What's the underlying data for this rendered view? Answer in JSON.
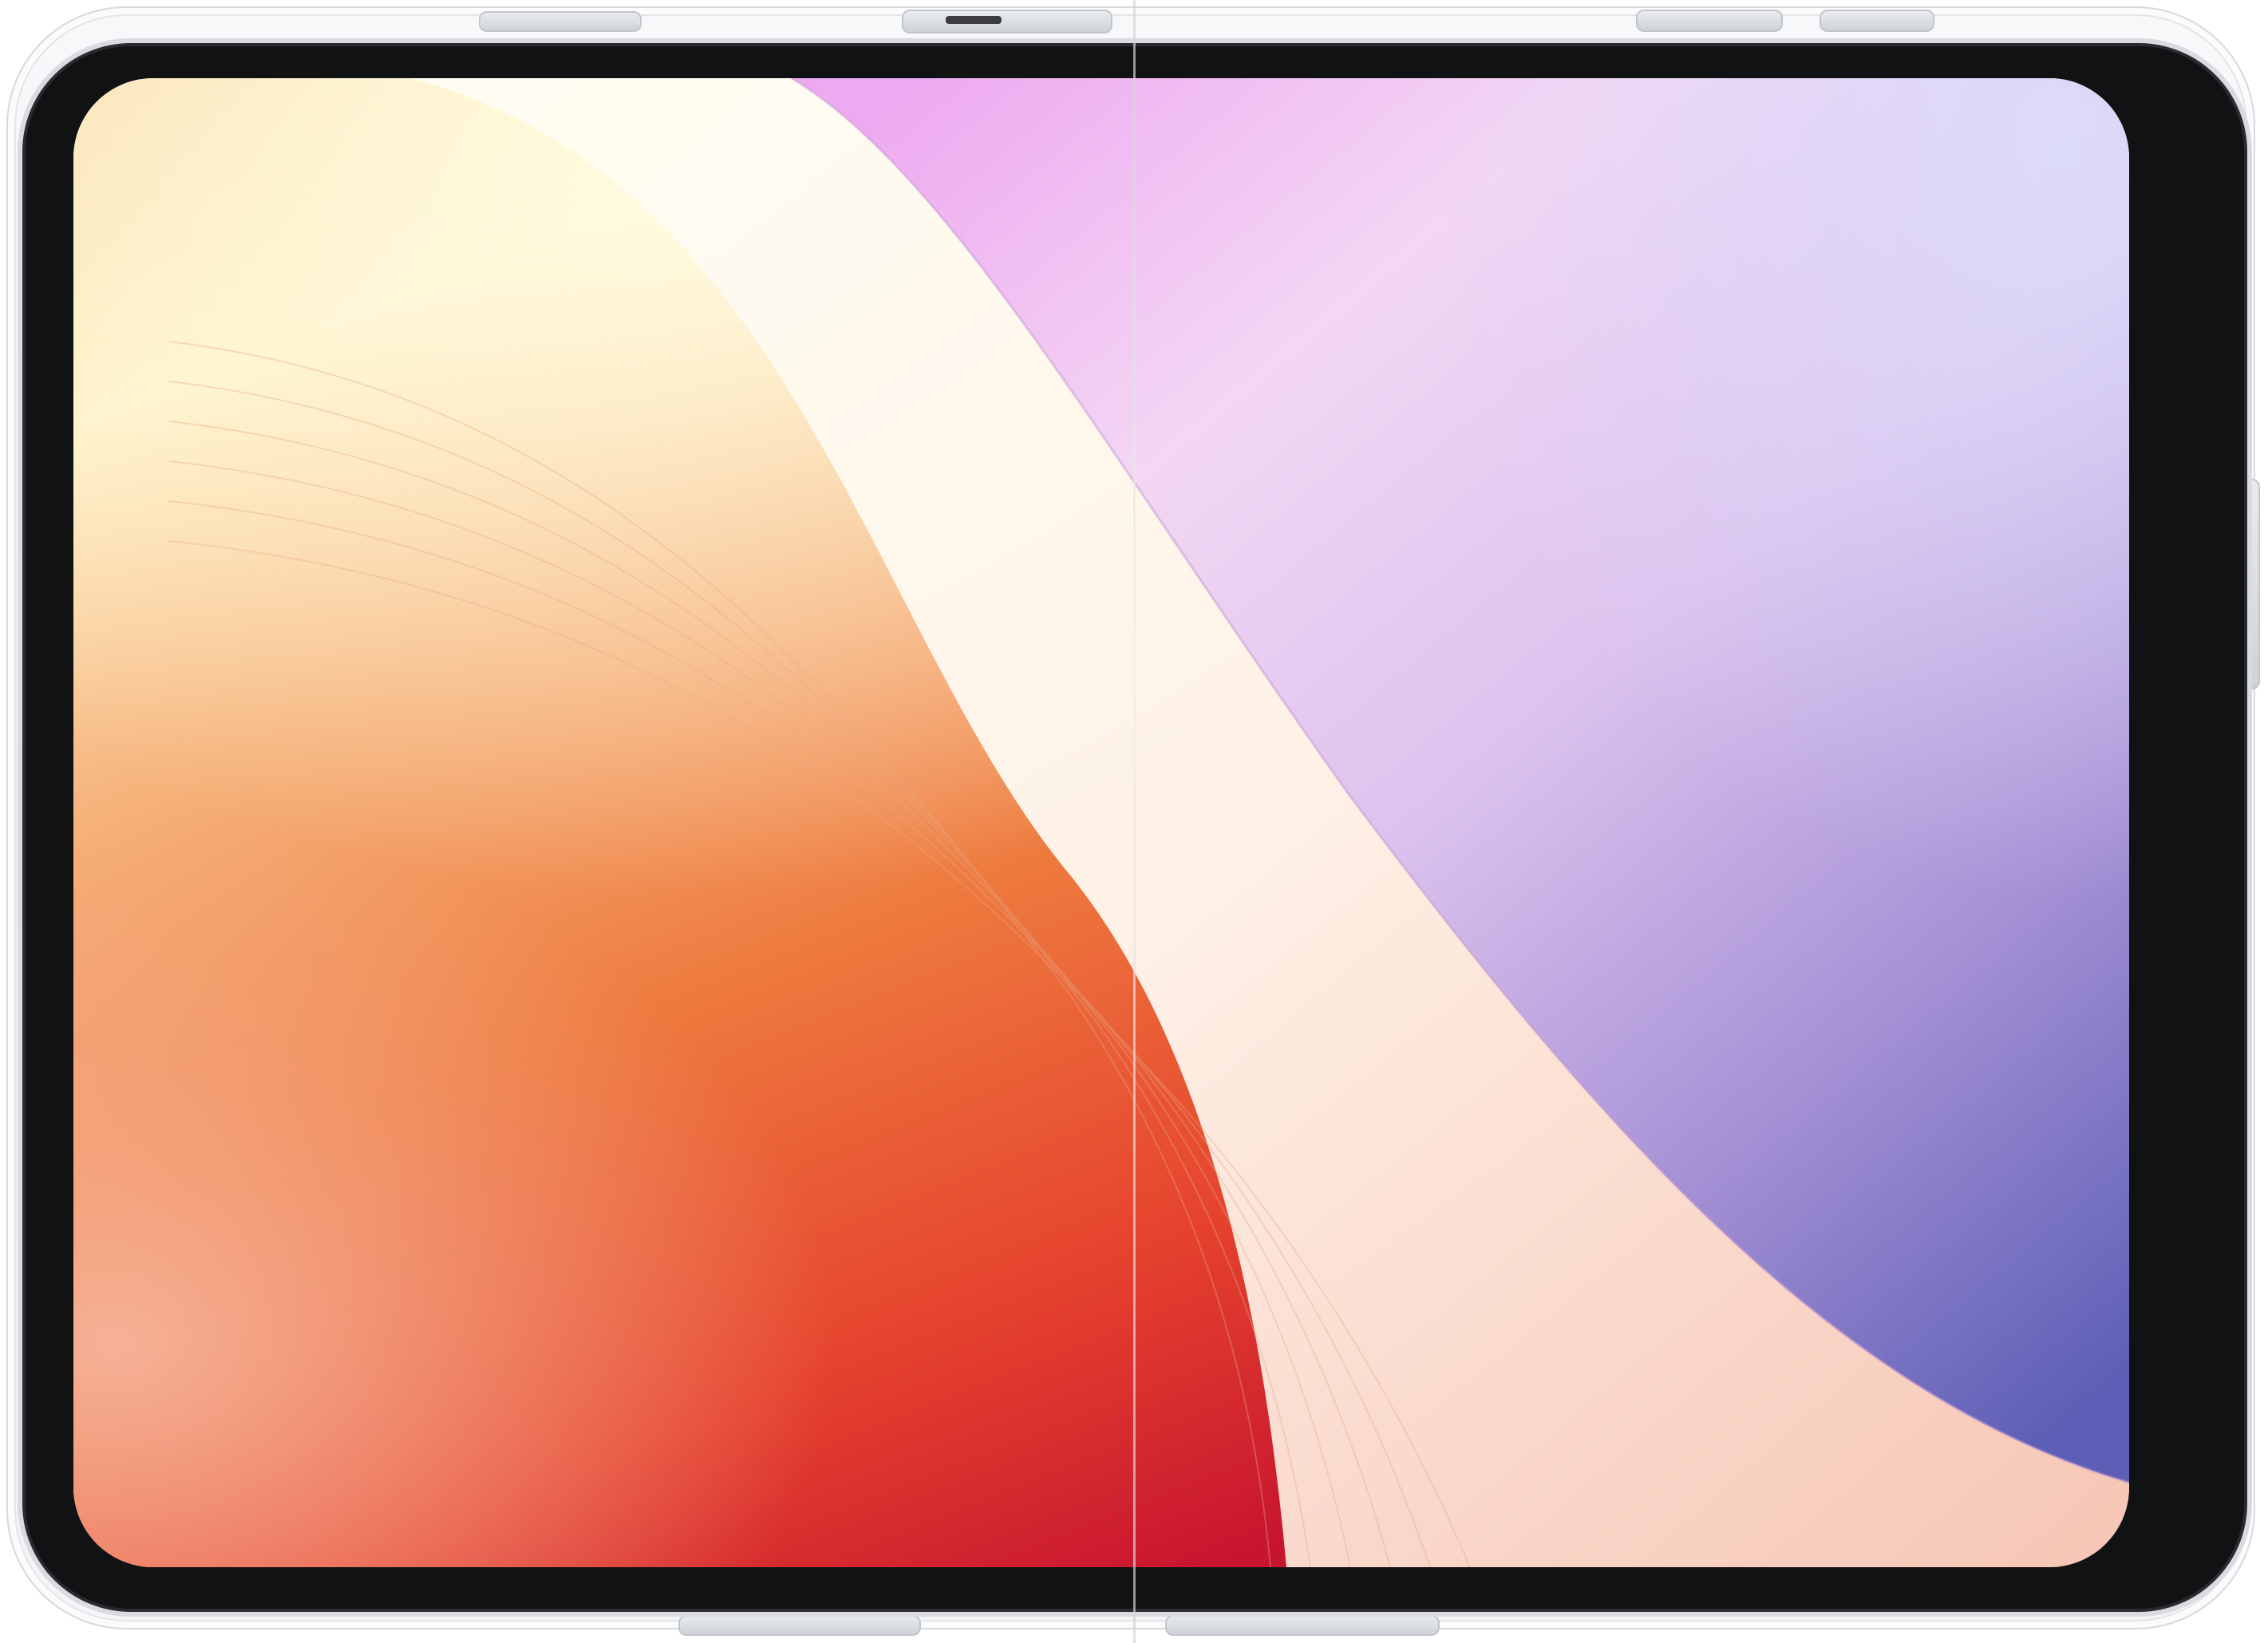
{
  "image": {
    "subject": "foldable-phone-in-clear-case",
    "colors": {
      "wallpaper_warm_light": "#fff4c8",
      "wallpaper_orange": "#ee7a3e",
      "wallpaper_red": "#d81e2c",
      "wallpaper_white_band": "#fff6ee",
      "wallpaper_magenta": "#f0b3ef",
      "wallpaper_lavender": "#d8c9f0",
      "wallpaper_purple_blue": "#6c6dbd",
      "bezel": "#111214",
      "case": "#eef0f3"
    }
  }
}
